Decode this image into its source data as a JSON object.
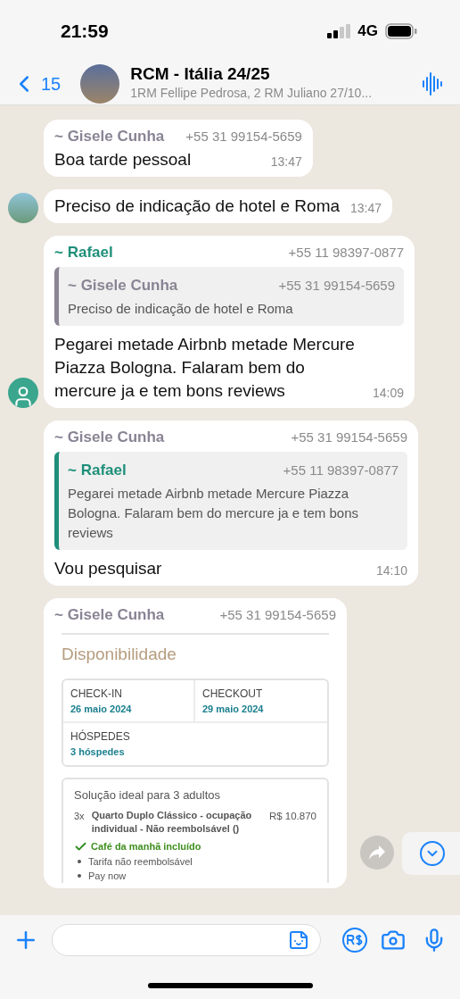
{
  "status_bar": {
    "time": "21:59",
    "network": "4G"
  },
  "header": {
    "back_count": "15",
    "title": "RCM - Itália 24/25",
    "subtitle": "1RM Fellipe Pedrosa, 2 RM Juliano 27/10..."
  },
  "messages": [
    {
      "kind": "text",
      "sender": "~ Gisele Cunha",
      "phone": "+55 31 99154-5659",
      "color": "#8a8494",
      "text": "Boa tarde pessoal",
      "time": "13:47"
    },
    {
      "kind": "text",
      "text": "Preciso de indicação de hotel e Roma",
      "time": "13:47",
      "avatar": {
        "kind": "photo"
      }
    },
    {
      "kind": "text",
      "sender": "~ Rafael",
      "phone": "+55 11 98397-0877",
      "color": "#1f8f7a",
      "quote": {
        "sender": "~ Gisele Cunha",
        "phone": "+55 31 99154-5659",
        "color": "#8a8494",
        "text": "Preciso de indicação de hotel e Roma"
      },
      "text": "Pegarei metade Airbnb metade Mercure Piazza Bologna. Falaram bem do mercure ja e tem bons reviews",
      "time": "14:09",
      "avatar": {
        "kind": "silhouette"
      }
    },
    {
      "kind": "text",
      "sender": "~ Gisele Cunha",
      "phone": "+55 31 99154-5659",
      "color": "#8a8494",
      "quote": {
        "sender": "~ Rafael",
        "phone": "+55 11 98397-0877",
        "color": "#1f8f7a",
        "text": "Pegarei metade Airbnb metade Mercure Piazza Bologna. Falaram bem do mercure ja e tem bons reviews"
      },
      "text": "Vou pesquisar",
      "time": "14:10"
    },
    {
      "kind": "booking",
      "sender": "~ Gisele Cunha",
      "phone": "+55 31 99154-5659",
      "color": "#8a8494",
      "booking": {
        "heading": "Disponibilidade",
        "fields": [
          {
            "label": "CHECK-IN",
            "value": "26 maio 2024"
          },
          {
            "label": "CHECKOUT",
            "value": "29 maio 2024"
          },
          {
            "label": "HÓSPEDES",
            "value": "3 hóspedes"
          }
        ],
        "offer": {
          "title": "Solução ideal para 3 adultos",
          "qty": "3x",
          "room": "Quarto Duplo Clássico - ocupação individual - Não reembolsável ()",
          "price": "R$ 10.870",
          "included": "Café da manhã incluído",
          "bullets": [
            "Tarifa não reembolsável",
            "Pay now"
          ]
        }
      }
    }
  ]
}
